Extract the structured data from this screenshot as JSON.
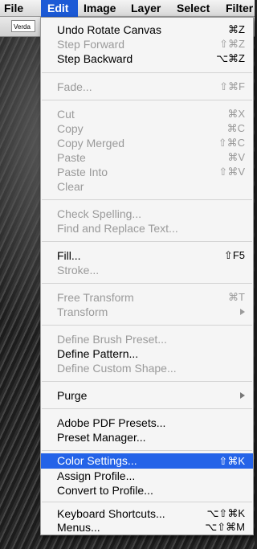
{
  "menubar": [
    {
      "label": "File"
    },
    {
      "label": "Edit"
    },
    {
      "label": "Image"
    },
    {
      "label": "Layer"
    },
    {
      "label": "Select"
    },
    {
      "label": "Filter"
    }
  ],
  "options_bar": {
    "font_field": "Verda"
  },
  "menu": {
    "items": [
      {
        "label": "Undo Rotate Canvas",
        "shortcut": "⌘Z",
        "disabled": false
      },
      {
        "label": "Step Forward",
        "shortcut": "⇧⌘Z",
        "disabled": true
      },
      {
        "label": "Step Backward",
        "shortcut": "⌥⌘Z",
        "disabled": false
      },
      {
        "label": "Fade...",
        "shortcut": "⇧⌘F",
        "disabled": true
      },
      {
        "label": "Cut",
        "shortcut": "⌘X",
        "disabled": true
      },
      {
        "label": "Copy",
        "shortcut": "⌘C",
        "disabled": true
      },
      {
        "label": "Copy Merged",
        "shortcut": "⇧⌘C",
        "disabled": true
      },
      {
        "label": "Paste",
        "shortcut": "⌘V",
        "disabled": true
      },
      {
        "label": "Paste Into",
        "shortcut": "⇧⌘V",
        "disabled": true
      },
      {
        "label": "Clear",
        "shortcut": "",
        "disabled": true
      },
      {
        "label": "Check Spelling...",
        "shortcut": "",
        "disabled": true
      },
      {
        "label": "Find and Replace Text...",
        "shortcut": "",
        "disabled": true
      },
      {
        "label": "Fill...",
        "shortcut": "⇧F5",
        "disabled": false
      },
      {
        "label": "Stroke...",
        "shortcut": "",
        "disabled": true
      },
      {
        "label": "Free Transform",
        "shortcut": "⌘T",
        "disabled": true
      },
      {
        "label": "Transform",
        "shortcut": "",
        "disabled": true,
        "submenu": true
      },
      {
        "label": "Define Brush Preset...",
        "shortcut": "",
        "disabled": true
      },
      {
        "label": "Define Pattern...",
        "shortcut": "",
        "disabled": false
      },
      {
        "label": "Define Custom Shape...",
        "shortcut": "",
        "disabled": true
      },
      {
        "label": "Purge",
        "shortcut": "",
        "disabled": false,
        "submenu": true
      },
      {
        "label": "Adobe PDF Presets...",
        "shortcut": "",
        "disabled": false
      },
      {
        "label": "Preset Manager...",
        "shortcut": "",
        "disabled": false
      },
      {
        "label": "Color Settings...",
        "shortcut": "⇧⌘K",
        "disabled": false,
        "highlighted": true
      },
      {
        "label": "Assign Profile...",
        "shortcut": "",
        "disabled": false
      },
      {
        "label": "Convert to Profile...",
        "shortcut": "",
        "disabled": false
      },
      {
        "label": "Keyboard Shortcuts...",
        "shortcut": "⌥⇧⌘K",
        "disabled": false
      },
      {
        "label": "Menus...",
        "shortcut": "⌥⇧⌘M",
        "disabled": false
      }
    ]
  },
  "colors": {
    "highlight": "#2463e8",
    "disabled_text": "#9a9a9a",
    "menu_bg": "#f5f5f5"
  }
}
